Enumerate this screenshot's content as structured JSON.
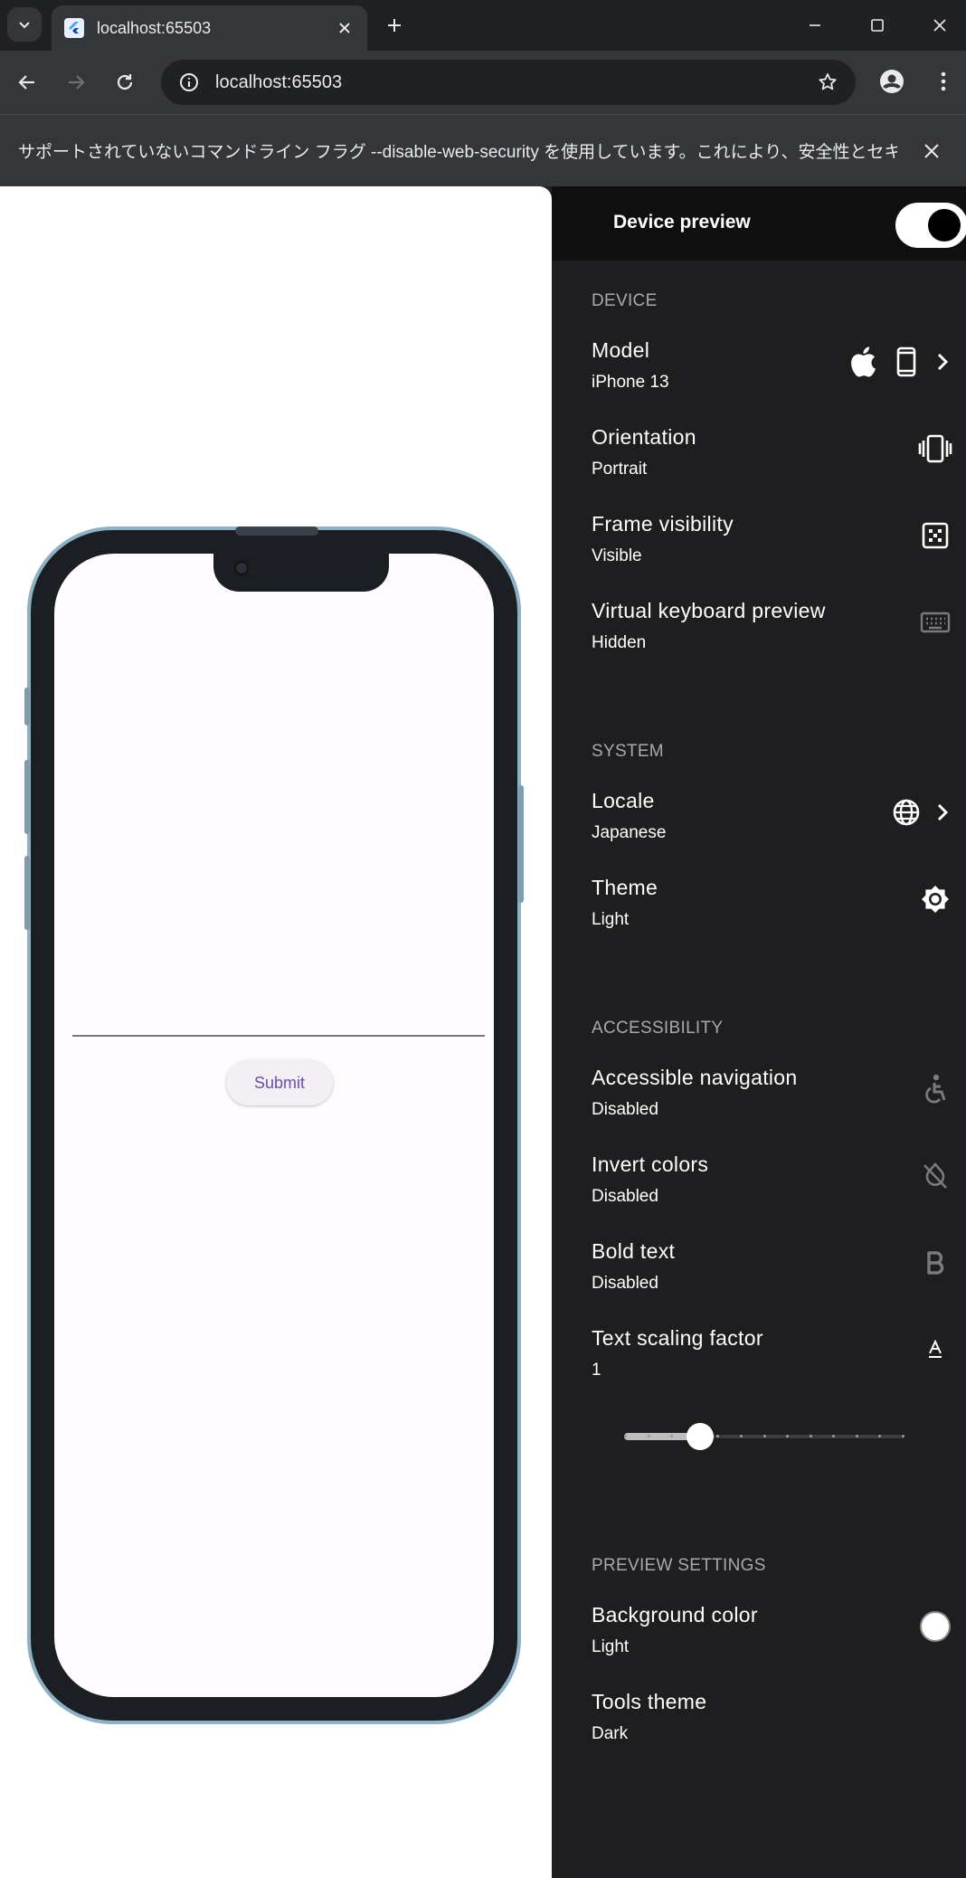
{
  "browser": {
    "tab_title": "localhost:65503",
    "url": "localhost:65503",
    "infobar_message": "サポートされていないコマンドライン フラグ --disable-web-security を使用しています。これにより、安全性とセキュリティが損なわ..."
  },
  "app": {
    "submit_label": "Submit"
  },
  "panel": {
    "title": "Device preview",
    "enabled": true,
    "sections": {
      "device": "DEVICE",
      "system": "SYSTEM",
      "accessibility": "ACCESSIBILITY",
      "preview_settings": "PREVIEW SETTINGS"
    },
    "model": {
      "label": "Model",
      "value": "iPhone 13",
      "icons": [
        "apple-icon",
        "phone-icon",
        "chevron-right-icon"
      ]
    },
    "orientation": {
      "label": "Orientation",
      "value": "Portrait",
      "icon": "screen-rotation-icon"
    },
    "frame_visibility": {
      "label": "Frame visibility",
      "value": "Visible",
      "icon": "frame-icon"
    },
    "keyboard": {
      "label": "Virtual keyboard preview",
      "value": "Hidden",
      "icon": "keyboard-icon"
    },
    "locale": {
      "label": "Locale",
      "value": "Japanese",
      "icons": [
        "globe-icon",
        "chevron-right-icon"
      ]
    },
    "theme": {
      "label": "Theme",
      "value": "Light",
      "icon": "brightness-icon"
    },
    "accessible_navigation": {
      "label": "Accessible navigation",
      "value": "Disabled",
      "icon": "accessibility-icon"
    },
    "invert_colors": {
      "label": "Invert colors",
      "value": "Disabled",
      "icon": "invert-colors-off-icon"
    },
    "bold_text": {
      "label": "Bold text",
      "value": "Disabled",
      "icon": "bold-icon"
    },
    "text_scaling": {
      "label": "Text scaling factor",
      "value": "1",
      "icon": "text-format-icon",
      "slider_position": 0.27,
      "slider_steps": 12
    },
    "background_color": {
      "label": "Background color",
      "value": "Light",
      "swatch": "#ffffff"
    },
    "tools_theme": {
      "label": "Tools theme",
      "value": "Dark"
    }
  },
  "colors": {
    "panel_bg": "#1e1e21",
    "header_bg": "#0f0f10",
    "chrome_dark": "#202124",
    "chrome_mid": "#35363a",
    "phone_frame": "#8fb1c6",
    "submit_text": "#6750a4"
  }
}
